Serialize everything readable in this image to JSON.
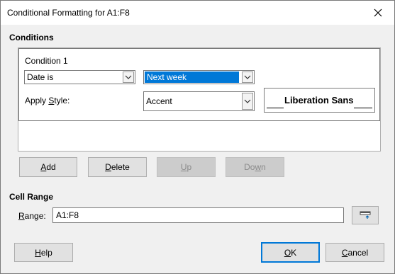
{
  "window": {
    "title": "Conditional Formatting for A1:F8",
    "close_icon": "close-icon"
  },
  "conditions": {
    "section_title": "Conditions",
    "condition_label": "Condition 1",
    "type_select": {
      "value": "Date is",
      "icon": "chevron-down-icon"
    },
    "date_select": {
      "value": "Next week",
      "icon": "chevron-down-icon"
    },
    "apply_style_label": {
      "before": "Apply ",
      "mnemonic": "S",
      "after": "tyle:"
    },
    "style_select": {
      "value": "Accent",
      "icon": "chevron-down-icon"
    },
    "preview_text": "Liberation Sans"
  },
  "buttons": {
    "add": {
      "mnemonic": "A",
      "rest": "dd"
    },
    "delete": {
      "mnemonic": "D",
      "rest": "elete"
    },
    "up": {
      "mnemonic": "U",
      "rest": "p"
    },
    "down": {
      "before": "Do",
      "mnemonic": "w",
      "after": "n"
    }
  },
  "cell_range": {
    "section_title": "Cell Range",
    "range_label": {
      "mnemonic": "R",
      "rest": "ange:"
    },
    "range_value": "A1:F8",
    "shrink_icon": "shrink-icon"
  },
  "footer": {
    "help": {
      "mnemonic": "H",
      "rest": "elp"
    },
    "ok": {
      "mnemonic": "O",
      "rest": "K"
    },
    "cancel": {
      "mnemonic": "C",
      "rest": "ancel"
    }
  }
}
